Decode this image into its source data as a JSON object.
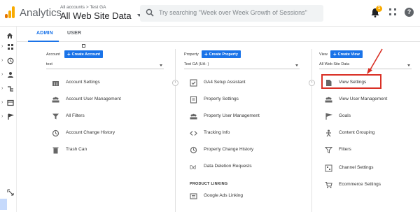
{
  "header": {
    "app_name": "Analytics",
    "breadcrumb": "All accounts > Test GA",
    "account_title": "All Web Site Data",
    "search_placeholder": "Try searching \"Week over Week Growth of Sessions\"",
    "notification_count": "1"
  },
  "tabs": {
    "admin": "ADMIN",
    "user": "USER"
  },
  "account_col": {
    "label": "Account",
    "create_label": "Create Account",
    "selected": "test",
    "items": [
      {
        "label": "Account Settings",
        "icon": "building-icon"
      },
      {
        "label": "Account User Management",
        "icon": "people-icon"
      },
      {
        "label": "All Filters",
        "icon": "filter-icon"
      },
      {
        "label": "Account Change History",
        "icon": "history-icon"
      },
      {
        "label": "Trash Can",
        "icon": "trash-icon"
      }
    ]
  },
  "property_col": {
    "label": "Property",
    "create_label": "Create Property",
    "selected": "Test GA (UA-                    )",
    "items": [
      {
        "label": "GA4 Setup Assistant",
        "icon": "checkbox-icon"
      },
      {
        "label": "Property Settings",
        "icon": "document-icon"
      },
      {
        "label": "Property User Management",
        "icon": "people-icon"
      },
      {
        "label": "Tracking Info",
        "icon": "code-icon"
      },
      {
        "label": "Property Change History",
        "icon": "history-icon"
      },
      {
        "label": "Data Deletion Requests",
        "icon": "dd-icon"
      }
    ],
    "section_label": "PRODUCT LINKING",
    "linking_items": [
      {
        "label": "Google Ads Linking",
        "icon": "ads-icon"
      }
    ]
  },
  "view_col": {
    "label": "View",
    "create_label": "Create View",
    "selected": "All Web Site Data",
    "items": [
      {
        "label": "View Settings",
        "icon": "page-icon"
      },
      {
        "label": "View User Management",
        "icon": "people-icon"
      },
      {
        "label": "Goals",
        "icon": "flag-icon"
      },
      {
        "label": "Content Grouping",
        "icon": "person-icon"
      },
      {
        "label": "Filters",
        "icon": "filter-icon"
      },
      {
        "label": "Channel Settings",
        "icon": "channel-icon"
      },
      {
        "label": "Ecommerce Settings",
        "icon": "cart-icon"
      }
    ]
  },
  "nav_dock_icon": "dock-icon",
  "colors": {
    "accent": "#1a73e8",
    "highlight": "#d93025",
    "logo_dark": "#e37400",
    "logo_light": "#f9ab00"
  }
}
